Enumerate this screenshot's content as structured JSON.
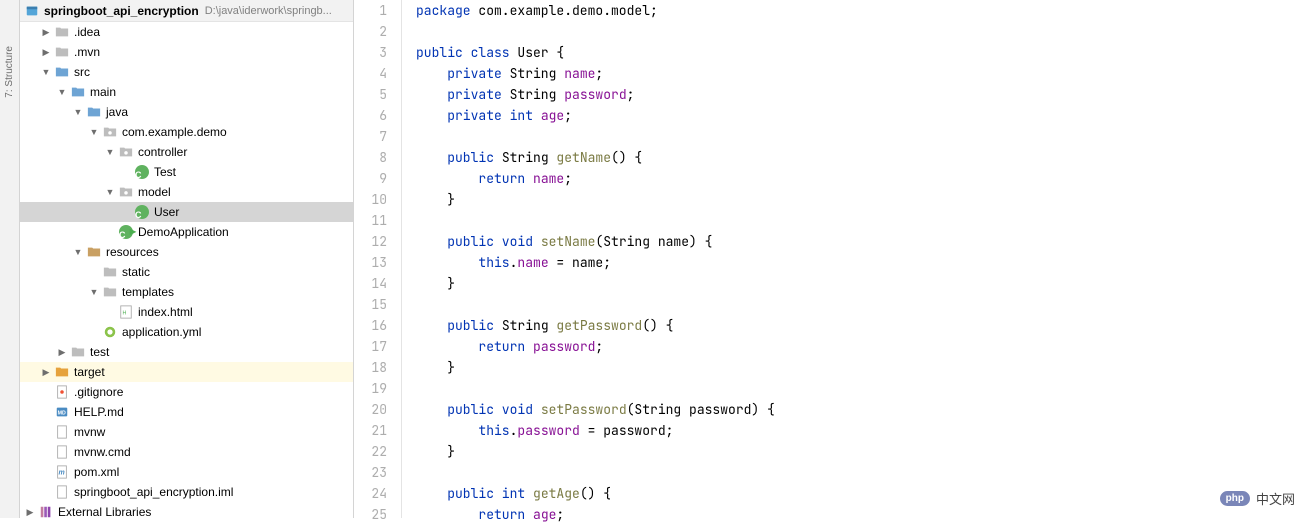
{
  "structure_tab": "7: Structure",
  "project": {
    "root": {
      "name": "springboot_api_encryption",
      "path": "D:\\java\\iderwork\\springb..."
    },
    "items": [
      {
        "depth": 1,
        "chev": "right",
        "icon": "folder",
        "label": ".idea"
      },
      {
        "depth": 1,
        "chev": "right",
        "icon": "folder",
        "label": ".mvn"
      },
      {
        "depth": 1,
        "chev": "down",
        "icon": "folder-blue",
        "label": "src"
      },
      {
        "depth": 2,
        "chev": "down",
        "icon": "folder-blue",
        "label": "main"
      },
      {
        "depth": 3,
        "chev": "down",
        "icon": "folder-blue",
        "label": "java"
      },
      {
        "depth": 4,
        "chev": "down",
        "icon": "package",
        "label": "com.example.demo"
      },
      {
        "depth": 5,
        "chev": "down",
        "icon": "package",
        "label": "controller"
      },
      {
        "depth": 6,
        "chev": "none",
        "icon": "class",
        "label": "Test"
      },
      {
        "depth": 5,
        "chev": "down",
        "icon": "package",
        "label": "model"
      },
      {
        "depth": 6,
        "chev": "none",
        "icon": "class",
        "label": "User",
        "selected": true
      },
      {
        "depth": 5,
        "chev": "none",
        "icon": "class-run",
        "label": "DemoApplication"
      },
      {
        "depth": 3,
        "chev": "down",
        "icon": "folder-brown",
        "label": "resources"
      },
      {
        "depth": 4,
        "chev": "none",
        "icon": "folder",
        "label": "static"
      },
      {
        "depth": 4,
        "chev": "down",
        "icon": "folder",
        "label": "templates"
      },
      {
        "depth": 5,
        "chev": "none",
        "icon": "html",
        "label": "index.html"
      },
      {
        "depth": 4,
        "chev": "none",
        "icon": "yml",
        "label": "application.yml"
      },
      {
        "depth": 2,
        "chev": "right",
        "icon": "folder",
        "label": "test"
      },
      {
        "depth": 1,
        "chev": "right",
        "icon": "folder-orange",
        "label": "target",
        "highlight": true
      },
      {
        "depth": 1,
        "chev": "none",
        "icon": "file-git",
        "label": ".gitignore"
      },
      {
        "depth": 1,
        "chev": "none",
        "icon": "file-md",
        "label": "HELP.md"
      },
      {
        "depth": 1,
        "chev": "none",
        "icon": "file",
        "label": "mvnw"
      },
      {
        "depth": 1,
        "chev": "none",
        "icon": "file",
        "label": "mvnw.cmd"
      },
      {
        "depth": 1,
        "chev": "none",
        "icon": "file-m",
        "label": "pom.xml"
      },
      {
        "depth": 1,
        "chev": "none",
        "icon": "file",
        "label": "springboot_api_encryption.iml"
      }
    ],
    "footer": "External Libraries"
  },
  "editor": {
    "lines": [
      {
        "n": 1,
        "tokens": [
          [
            "kw",
            "package"
          ],
          [
            "plain",
            " com.example.demo.model;"
          ]
        ]
      },
      {
        "n": 2,
        "tokens": []
      },
      {
        "n": 3,
        "tokens": [
          [
            "kw",
            "public class "
          ],
          [
            "plain",
            "User {"
          ]
        ]
      },
      {
        "n": 4,
        "tokens": [
          [
            "plain",
            "    "
          ],
          [
            "kw",
            "private "
          ],
          [
            "plain",
            "String "
          ],
          [
            "ident",
            "name"
          ],
          [
            "plain",
            ";"
          ]
        ]
      },
      {
        "n": 5,
        "tokens": [
          [
            "plain",
            "    "
          ],
          [
            "kw",
            "private "
          ],
          [
            "plain",
            "String "
          ],
          [
            "ident",
            "password"
          ],
          [
            "plain",
            ";"
          ]
        ]
      },
      {
        "n": 6,
        "tokens": [
          [
            "plain",
            "    "
          ],
          [
            "kw",
            "private int "
          ],
          [
            "ident",
            "age"
          ],
          [
            "plain",
            ";"
          ]
        ]
      },
      {
        "n": 7,
        "tokens": []
      },
      {
        "n": 8,
        "tokens": [
          [
            "plain",
            "    "
          ],
          [
            "kw",
            "public "
          ],
          [
            "plain",
            "String "
          ],
          [
            "method",
            "getName"
          ],
          [
            "plain",
            "() {"
          ]
        ]
      },
      {
        "n": 9,
        "tokens": [
          [
            "plain",
            "        "
          ],
          [
            "kw",
            "return "
          ],
          [
            "ident",
            "name"
          ],
          [
            "plain",
            ";"
          ]
        ]
      },
      {
        "n": 10,
        "tokens": [
          [
            "plain",
            "    }"
          ]
        ]
      },
      {
        "n": 11,
        "tokens": []
      },
      {
        "n": 12,
        "tokens": [
          [
            "plain",
            "    "
          ],
          [
            "kw",
            "public void "
          ],
          [
            "method",
            "setName"
          ],
          [
            "plain",
            "(String name) {"
          ]
        ]
      },
      {
        "n": 13,
        "tokens": [
          [
            "plain",
            "        "
          ],
          [
            "kw",
            "this"
          ],
          [
            "plain",
            "."
          ],
          [
            "ident",
            "name"
          ],
          [
            "plain",
            " = name;"
          ]
        ]
      },
      {
        "n": 14,
        "tokens": [
          [
            "plain",
            "    }"
          ]
        ]
      },
      {
        "n": 15,
        "tokens": []
      },
      {
        "n": 16,
        "tokens": [
          [
            "plain",
            "    "
          ],
          [
            "kw",
            "public "
          ],
          [
            "plain",
            "String "
          ],
          [
            "method",
            "getPassword"
          ],
          [
            "plain",
            "() {"
          ]
        ]
      },
      {
        "n": 17,
        "tokens": [
          [
            "plain",
            "        "
          ],
          [
            "kw",
            "return "
          ],
          [
            "ident",
            "password"
          ],
          [
            "plain",
            ";"
          ]
        ]
      },
      {
        "n": 18,
        "tokens": [
          [
            "plain",
            "    }"
          ]
        ]
      },
      {
        "n": 19,
        "tokens": []
      },
      {
        "n": 20,
        "tokens": [
          [
            "plain",
            "    "
          ],
          [
            "kw",
            "public void "
          ],
          [
            "method",
            "setPassword"
          ],
          [
            "plain",
            "(String password) {"
          ]
        ]
      },
      {
        "n": 21,
        "tokens": [
          [
            "plain",
            "        "
          ],
          [
            "kw",
            "this"
          ],
          [
            "plain",
            "."
          ],
          [
            "ident",
            "password"
          ],
          [
            "plain",
            " = password;"
          ]
        ]
      },
      {
        "n": 22,
        "tokens": [
          [
            "plain",
            "    }"
          ]
        ]
      },
      {
        "n": 23,
        "tokens": []
      },
      {
        "n": 24,
        "tokens": [
          [
            "plain",
            "    "
          ],
          [
            "kw",
            "public int "
          ],
          [
            "method",
            "getAge"
          ],
          [
            "plain",
            "() {"
          ]
        ]
      },
      {
        "n": 25,
        "tokens": [
          [
            "plain",
            "        "
          ],
          [
            "kw",
            "return "
          ],
          [
            "ident",
            "age"
          ],
          [
            "plain",
            ";"
          ]
        ]
      }
    ]
  },
  "watermark": {
    "badge": "php",
    "text": "中文网"
  }
}
